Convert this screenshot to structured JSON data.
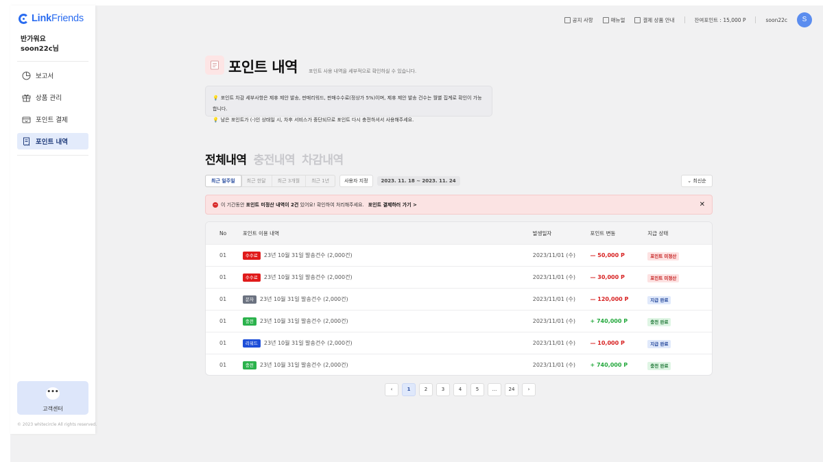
{
  "brand": {
    "name_bold": "Link",
    "name_light": "Friends"
  },
  "sidebar": {
    "greeting": "반가워요",
    "user": "soon22c님",
    "items": [
      {
        "label": "보고서",
        "icon": "pie-chart-icon"
      },
      {
        "label": "상품 관리",
        "icon": "gift-icon"
      },
      {
        "label": "포인트 결제",
        "icon": "voucher-icon"
      },
      {
        "label": "포인트 내역",
        "icon": "receipt-icon",
        "active": true
      }
    ],
    "cs_label": "고객센터",
    "copyright": "© 2023 whitecircle All rights reserved."
  },
  "topbar": {
    "notice": "공지 사항",
    "manual": "매뉴얼",
    "payment_guide": "결제 상품 안내",
    "balance": "잔여포인트 : 15,000 P",
    "username": "soon22c",
    "avatar_letter": "S"
  },
  "header": {
    "title": "포인트 내역",
    "subtitle": "포인트 사용 내역을 세부적으로 확인하실 수 있습니다.",
    "notices": [
      "포인트 차감 세부사항은 제휴 제안 발송, 판매리워드, 판매수수료(정상가 5%)이며, 제휴 제안 발송 건수는 월별 집계로 확인이 가능합니다.",
      "남은 포인트가 (-)인 상태일 시, 차후 서비스가 중단되므로 포인트 다시 충전하셔서 사용해주세요."
    ]
  },
  "tabs": [
    {
      "label": "전체내역",
      "active": true
    },
    {
      "label": "충전내역",
      "active": false
    },
    {
      "label": "차감내역",
      "active": false
    }
  ],
  "filter": {
    "periods": [
      "최근 일주일",
      "최근 한달",
      "최근 3개월",
      "최근 1년"
    ],
    "custom": "사용자 지정",
    "range": "2023. 11. 18 ~ 2023. 11. 24",
    "sort": "최신순"
  },
  "alert": {
    "prefix": "이 기간동안",
    "bold": "포인트 미정산 내역이 2건",
    "suffix": "있어요! 확인하여 처리해주세요.",
    "link": "포인트 결제하러 가기 >"
  },
  "table": {
    "headers": [
      "No",
      "포인트 이용 내역",
      "발생일자",
      "포인트 변동",
      "지급 상태"
    ],
    "rows": [
      {
        "no": "01",
        "tag": "수수료",
        "tag_color": "#e01b1b",
        "desc": "23년 10월 31일 발송건수 (2,000건)",
        "date": "2023/11/01 (수)",
        "points": "— 50,000 P",
        "sign": "neg",
        "status": "포인트 미정산",
        "status_type": "unpaid"
      },
      {
        "no": "01",
        "tag": "수수료",
        "tag_color": "#e01b1b",
        "desc": "23년 10월 31일 발송건수 (2,000건)",
        "date": "2023/11/01 (수)",
        "points": "— 30,000 P",
        "sign": "neg",
        "status": "포인트 미정산",
        "status_type": "unpaid"
      },
      {
        "no": "01",
        "tag": "문자",
        "tag_color": "#6b7280",
        "desc": "23년 10월 31일 발송건수 (2,000건)",
        "date": "2023/11/01 (수)",
        "points": "— 120,000 P",
        "sign": "neg",
        "status": "지급 완료",
        "status_type": "done"
      },
      {
        "no": "01",
        "tag": "충전",
        "tag_color": "#2bb24c",
        "desc": "23년 10월 31일 발송건수 (2,000건)",
        "date": "2023/11/01 (수)",
        "points": "+ 740,000 P",
        "sign": "pos",
        "status": "충전 완료",
        "status_type": "charged"
      },
      {
        "no": "01",
        "tag": "리워드",
        "tag_color": "#1d4ed8",
        "desc": "23년 10월 31일 발송건수 (2,000건)",
        "date": "2023/11/01 (수)",
        "points": "— 10,000 P",
        "sign": "neg",
        "status": "지급 완료",
        "status_type": "done"
      },
      {
        "no": "01",
        "tag": "충전",
        "tag_color": "#2bb24c",
        "desc": "23년 10월 31일 발송건수 (2,000건)",
        "date": "2023/11/01 (수)",
        "points": "+ 740,000 P",
        "sign": "pos",
        "status": "충전 완료",
        "status_type": "charged"
      }
    ]
  },
  "pagination": {
    "prev": "‹",
    "pages": [
      "1",
      "2",
      "3",
      "4",
      "5",
      "...",
      "24"
    ],
    "current": "1",
    "next": "›"
  }
}
